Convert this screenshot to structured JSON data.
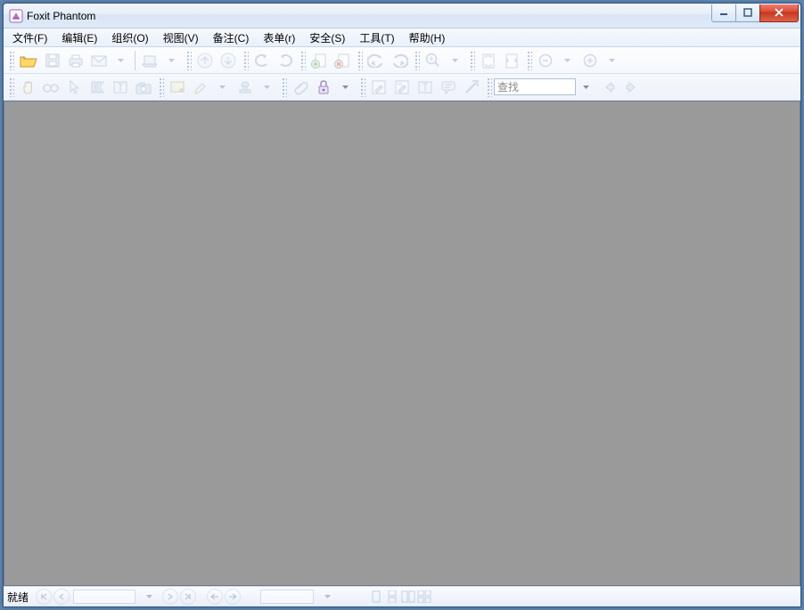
{
  "app": {
    "title": "Foxit Phantom"
  },
  "menu": {
    "file": "文件(F)",
    "edit": "编辑(E)",
    "organize": "组织(O)",
    "view": "视图(V)",
    "comments": "备注(C)",
    "forms": "表单(r)",
    "secure": "安全(S)",
    "tools": "工具(T)",
    "help": "帮助(H)"
  },
  "search": {
    "placeholder": "查找"
  },
  "status": {
    "ready": "就绪"
  }
}
